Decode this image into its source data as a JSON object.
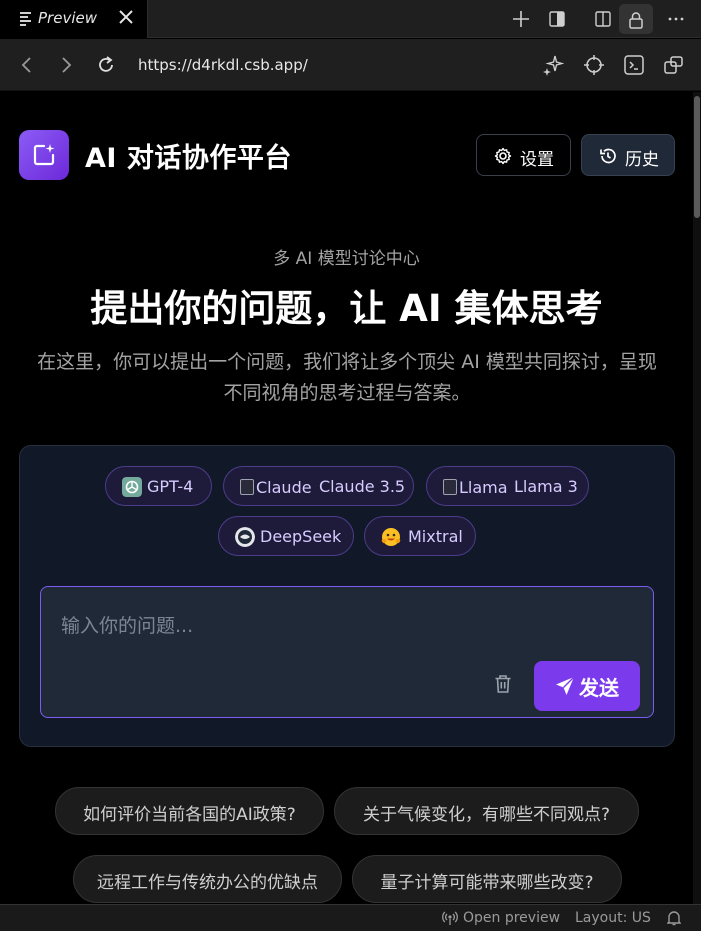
{
  "tab": {
    "title": "Preview",
    "icon": "document-lines-icon"
  },
  "tab_actions": [
    "plus-icon",
    "split-panel-icon",
    "columns-icon",
    "lock-icon",
    "more-icon"
  ],
  "address": {
    "url": "https://d4rkdl.csb.app/"
  },
  "header": {
    "title": "AI 对话协作平台",
    "settings_label": "设置",
    "history_label": "历史"
  },
  "hero": {
    "kicker": "多 AI 模型讨论中心",
    "headline": "提出你的问题，让 AI 集体思考",
    "description_line1": "在这里，你可以提出一个问题，我们将让多个顶尖 AI 模型共同探讨，呈现",
    "description_line2": "不同视角的思考过程与答案。"
  },
  "models": [
    {
      "label": "GPT-4",
      "alt": ""
    },
    {
      "label": "Claude 3.5",
      "alt": "Claude"
    },
    {
      "label": "Llama 3",
      "alt": "Llama"
    },
    {
      "label": "DeepSeek",
      "alt": ""
    },
    {
      "label": "Mixtral",
      "alt": ""
    }
  ],
  "composer": {
    "placeholder": "输入你的问题...",
    "send_label": "发送"
  },
  "suggestions": [
    "如何评价当前各国的AI政策?",
    "关于气候变化，有哪些不同观点?",
    "远程工作与传统办公的优缺点",
    "量子计算可能带来哪些改变?"
  ],
  "status": {
    "open_preview": "Open preview",
    "layout": "Layout: US"
  },
  "colors": {
    "accent": "#7c3aed",
    "panel": "#111827",
    "chip_border": "#4c3c8a"
  }
}
